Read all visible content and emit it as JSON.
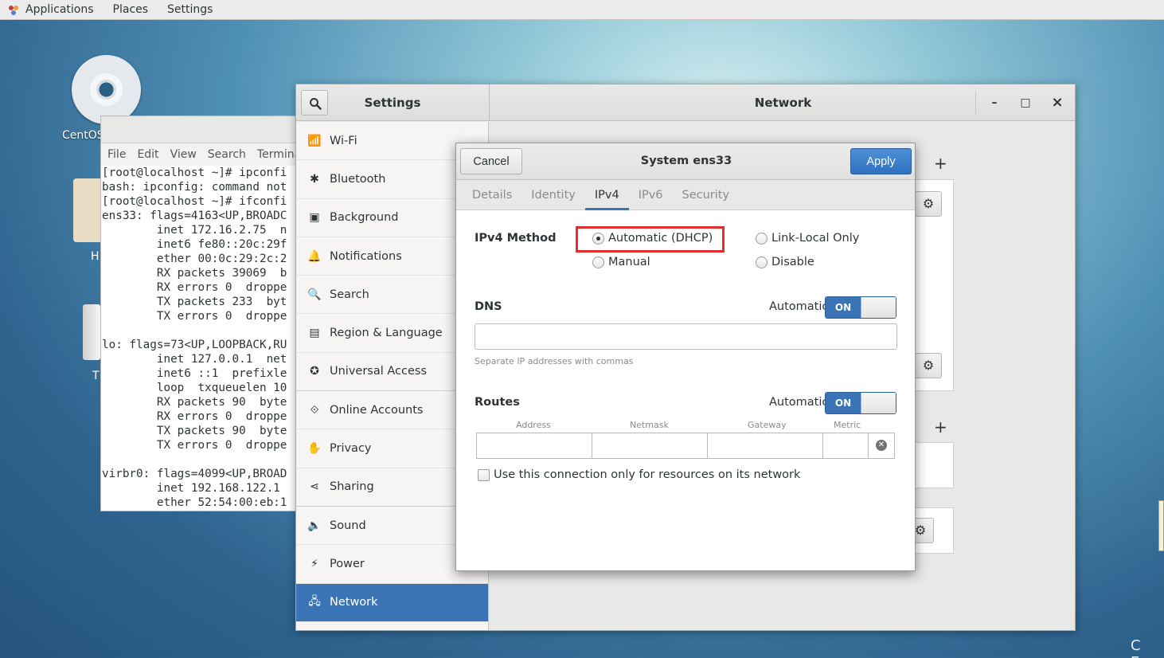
{
  "topbar": {
    "applications": "Applications",
    "places": "Places",
    "settings": "Settings"
  },
  "desktop": {
    "disc_label": "CentOS",
    "home_label": "H",
    "trash_label": "T",
    "corner_text": "C E"
  },
  "terminal": {
    "menu": [
      "File",
      "Edit",
      "View",
      "Search",
      "Termina"
    ],
    "output": "[root@localhost ~]# ipconfi\nbash: ipconfig: command not\n[root@localhost ~]# ifconfi\nens33: flags=4163<UP,BROADC\n        inet 172.16.2.75  n\n        inet6 fe80::20c:29f\n        ether 00:0c:29:2c:2\n        RX packets 39069  b\n        RX errors 0  droppe\n        TX packets 233  byt\n        TX errors 0  droppe\n\nlo: flags=73<UP,LOOPBACK,RU\n        inet 127.0.0.1  net\n        inet6 ::1  prefixle\n        loop  txqueuelen 10\n        RX packets 90  byte\n        RX errors 0  droppe\n        TX packets 90  byte\n        TX errors 0  droppe\n\nvirbr0: flags=4099<UP,BROAD\n        inet 192.168.122.1\n        ether 52:54:00:eb:1"
  },
  "settings": {
    "title": "Settings",
    "panel_title": "Network",
    "window_controls": {
      "minimize": "–",
      "maximize": "□",
      "close": "×"
    },
    "sidebar": [
      {
        "label": "Wi-Fi",
        "icon": "📶"
      },
      {
        "label": "Bluetooth",
        "icon": "✱"
      },
      {
        "label": "Background",
        "icon": "▣"
      },
      {
        "label": "Notifications",
        "icon": "🔔"
      },
      {
        "label": "Search",
        "icon": "🔍"
      },
      {
        "label": "Region & Language",
        "icon": "▤"
      },
      {
        "label": "Universal Access",
        "icon": "✪"
      },
      {
        "label": "Online Accounts",
        "icon": "⟐"
      },
      {
        "label": "Privacy",
        "icon": "✋"
      },
      {
        "label": "Sharing",
        "icon": "⋖"
      },
      {
        "label": "Sound",
        "icon": "🔈"
      },
      {
        "label": "Power",
        "icon": "⚡"
      },
      {
        "label": "Network",
        "icon": "🖧"
      }
    ],
    "plus_glyph": "+",
    "gear_glyph": "⚙"
  },
  "dialog": {
    "title": "System ens33",
    "cancel": "Cancel",
    "apply": "Apply",
    "tabs": [
      "Details",
      "Identity",
      "IPv4",
      "IPv6",
      "Security"
    ],
    "active_tab": "IPv4",
    "ipv4_method_label": "IPv4 Method",
    "methods": {
      "automatic_dhcp": "Automatic (DHCP)",
      "link_local": "Link-Local Only",
      "manual": "Manual",
      "disable": "Disable"
    },
    "selected_method": "Automatic (DHCP)",
    "dns": {
      "label": "DNS",
      "automatic_label": "Automatic",
      "switch": "ON",
      "value": "",
      "hint": "Separate IP addresses with commas"
    },
    "routes": {
      "label": "Routes",
      "automatic_label": "Automatic",
      "switch": "ON",
      "columns": [
        "Address",
        "Netmask",
        "Gateway",
        "Metric"
      ],
      "clear_glyph": "✕"
    },
    "only_resources_label": "Use this connection only for resources on its network",
    "accent_color": "#3b74b5",
    "highlight_color": "#e52d2d"
  }
}
